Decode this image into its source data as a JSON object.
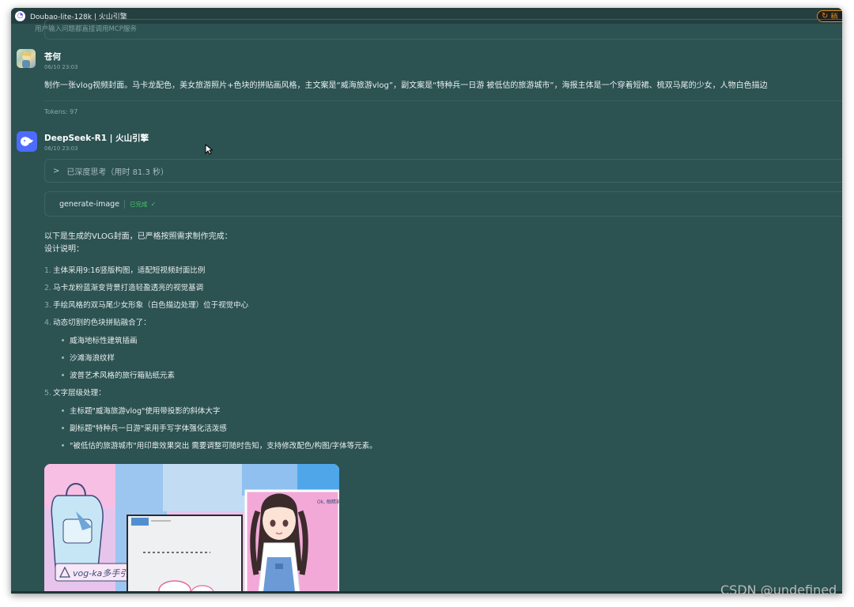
{
  "window": {
    "title": "Doubao-lite-128k | 火山引擎",
    "action_label": "稍"
  },
  "previous_message": {
    "text": "用户输入问题都直接调用MCP服务"
  },
  "user_message": {
    "name": "苍何",
    "time": "06/10 23:03",
    "text": "制作一张vlog视频封面。马卡龙配色，美女旅游照片+色块的拼贴画风格，主文案是“威海旅游vlog”，副文案是“特种兵一日游 被低估的旅游城市”，海报主体是一个穿着短裙、梳双马尾的少女，人物白色描边",
    "tokens": "Tokens: 97"
  },
  "assistant_message": {
    "name": "DeepSeek-R1 | 火山引擎",
    "time": "06/10 23:03",
    "thinking_label": "已深度思考（用时 81.3 秒）",
    "tool": {
      "name": "generate-image",
      "status": "已完成"
    },
    "intro": "以下是生成的VLOG封面，已严格按照需求制作完成：",
    "design_title": "设计说明：",
    "items": [
      {
        "num": "1.",
        "text": "主体采用9:16竖版构图，适配短视频封面比例"
      },
      {
        "num": "2.",
        "text": "马卡龙粉蓝渐变背景打造轻盈透亮的视觉基调"
      },
      {
        "num": "3.",
        "text": "手绘风格的双马尾少女形象（白色描边处理）位于视觉中心"
      },
      {
        "num": "4.",
        "text": "动态切割的色块拼贴融合了："
      },
      {
        "num": "5.",
        "text": "文字层级处理："
      }
    ],
    "sub_items_4": [
      "威海地标性建筑插画",
      "沙滩海浪纹样",
      "波普艺术风格的旅行箱贴纸元素"
    ],
    "sub_items_5": [
      "主标题\"威海旅游vlog\"使用带投影的斜体大字",
      "副标题\"特种兵一日游\"采用手写字体强化活泼感",
      "\"被低估的旅游城市\"用印章效果突出 需要调整可随时告知，支持修改配色/构图/字体等元素。"
    ],
    "image_sign_text": "vog-ka多手引",
    "image_note_text": "Ok, 眼睛前面才有的"
  },
  "watermark": "CSDN @undefined",
  "colors": {
    "background": "#2c5252",
    "titlebar": "#243f40",
    "accent_success": "#49c26c",
    "deepseek_blue": "#4d6bfe"
  }
}
